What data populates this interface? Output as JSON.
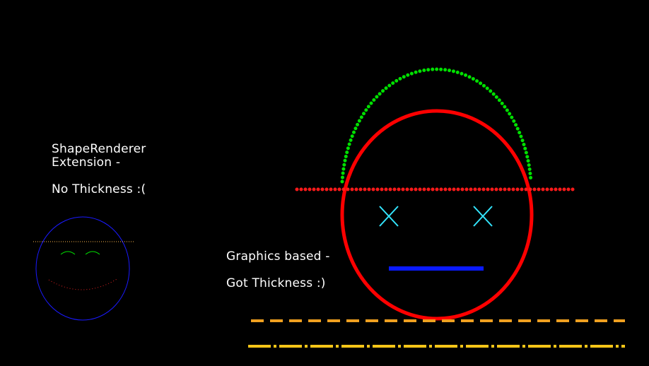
{
  "shape_renderer_panel": {
    "title_line_1": "ShapeRenderer",
    "title_line_2": "Extension -",
    "note": "No Thickness :("
  },
  "graphics_panel": {
    "title": "Graphics based -",
    "note": "Got Thickness :)"
  },
  "colors": {
    "background": "#000000",
    "text": "#ffffff",
    "thin_face_outline": "#1a1aff",
    "thin_brim_dotted": "#ffb84d",
    "thin_eyes": "#00e000",
    "thin_mouth_dotted": "#e02020",
    "thick_face_outline": "#ff0000",
    "hat_dome_dotted": "#00e000",
    "hat_brim_dotted": "#ff1a1a",
    "eyes_cross": "#33e6ff",
    "mouth_line": "#0a1aff",
    "dashed_line": "#f0a020",
    "dash_dot_line": "#f5c518"
  }
}
